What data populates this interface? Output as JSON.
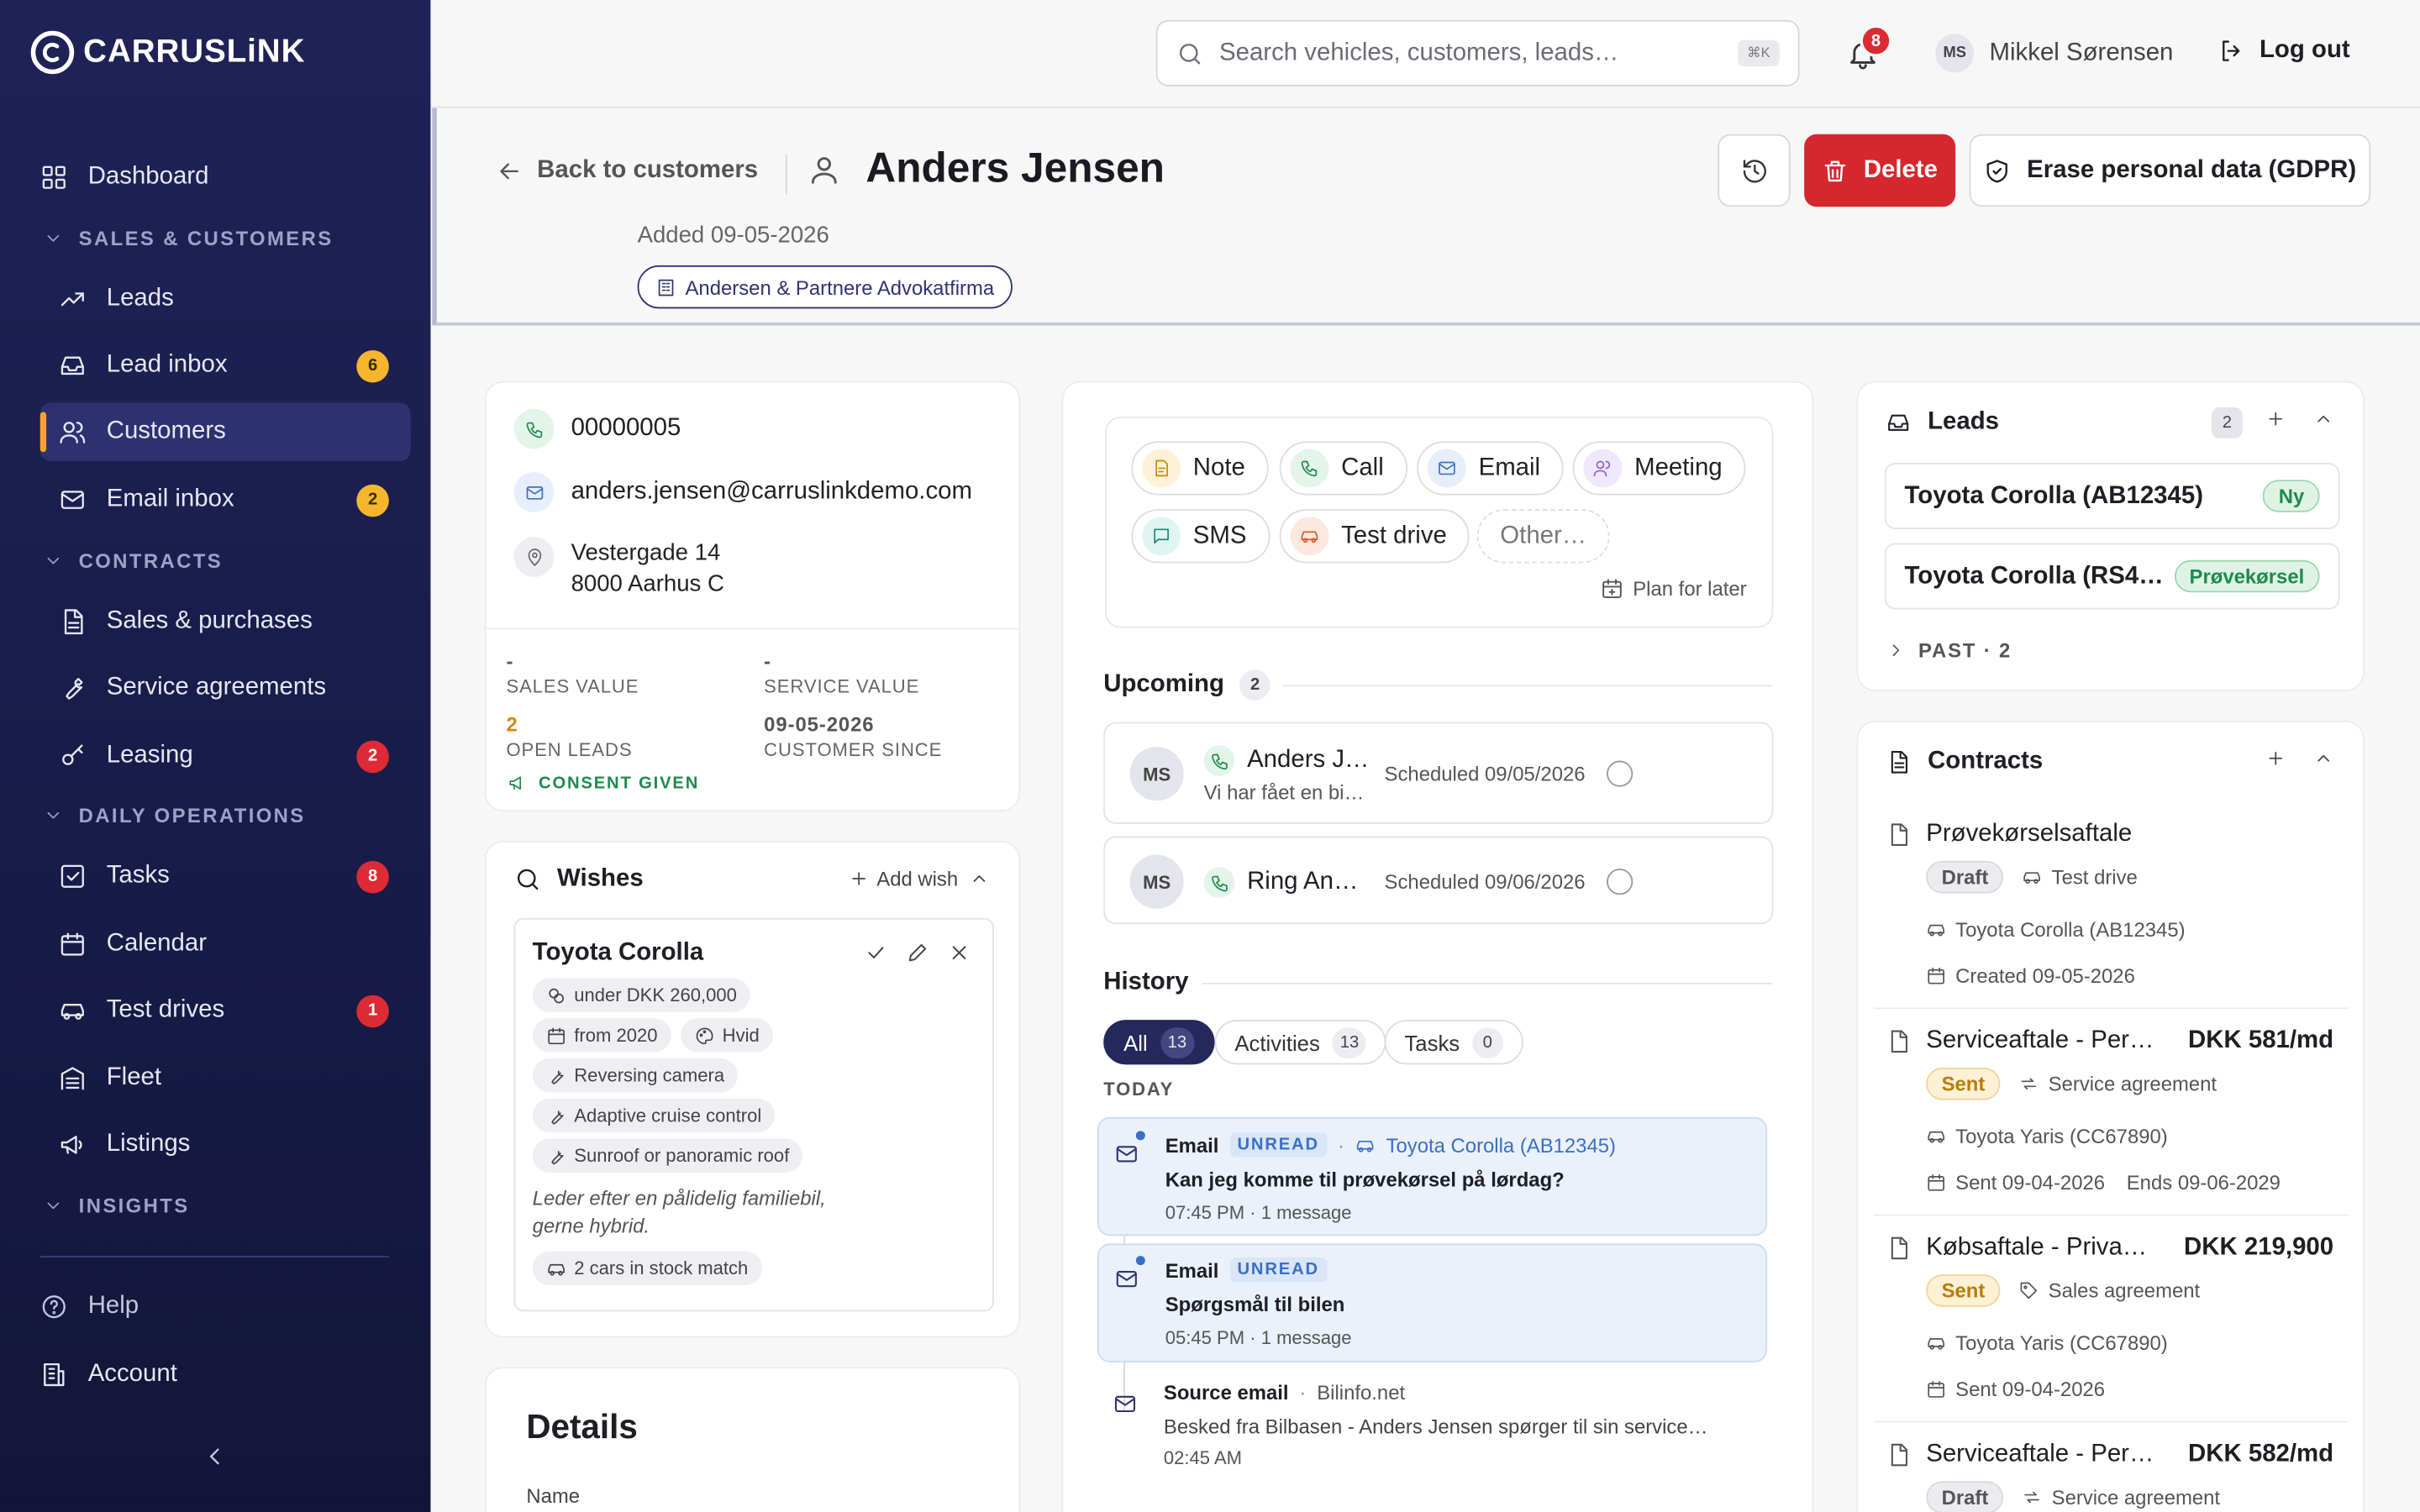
{
  "sidebar": {
    "brand": "CARRUSLiNK",
    "dashboard": "Dashboard",
    "sections": {
      "sales": "SALES & CUSTOMERS",
      "contracts": "CONTRACTS",
      "daily": "DAILY OPERATIONS",
      "insights": "INSIGHTS"
    },
    "items": {
      "leads": "Leads",
      "lead_inbox": "Lead inbox",
      "customers": "Customers",
      "email_inbox": "Email inbox",
      "sales_purchases": "Sales & purchases",
      "service_agreements": "Service agreements",
      "leasing": "Leasing",
      "tasks": "Tasks",
      "calendar": "Calendar",
      "test_drives": "Test drives",
      "fleet": "Fleet",
      "listings": "Listings"
    },
    "badges": {
      "lead_inbox": "6",
      "email_inbox": "2",
      "leasing": "2",
      "tasks": "8",
      "test_drives": "1"
    },
    "help": "Help",
    "account": "Account"
  },
  "topbar": {
    "search_placeholder": "Search vehicles, customers, leads…",
    "shortcut": "⌘K",
    "notifications": "8",
    "user_initials": "MS",
    "user_name": "Mikkel Sørensen",
    "logout": "Log out"
  },
  "header": {
    "back": "Back to customers",
    "name": "Anders Jensen",
    "added": "Added 09-05-2026",
    "company": "Andersen & Partnere Advokatfirma",
    "delete": "Delete",
    "gdpr": "Erase personal data (GDPR)"
  },
  "contact": {
    "phone": "00000005",
    "email": "anders.jensen@carruslinkdemo.com",
    "address_line1": "Vestergade 14",
    "address_line2": "8000 Aarhus C",
    "sales_value": "-",
    "sales_value_label": "SALES VALUE",
    "service_value": "-",
    "service_value_label": "SERVICE VALUE",
    "open_leads": "2",
    "open_leads_label": "OPEN LEADS",
    "customer_since": "09-05-2026",
    "customer_since_label": "CUSTOMER SINCE",
    "consent": "CONSENT GIVEN"
  },
  "wishes": {
    "title": "Wishes",
    "add": "Add wish",
    "car": "Toyota Corolla",
    "price": "under DKK 260,000",
    "year": "from 2020",
    "color": "Hvid",
    "features": [
      "Reversing camera",
      "Adaptive cruise control",
      "Sunroof or panoramic roof"
    ],
    "note": "Leder efter en pålidelig familiebil, gerne hybrid.",
    "stock_match": "2 cars in stock match"
  },
  "details": {
    "title": "Details",
    "name_label": "Name"
  },
  "activity": {
    "actions": {
      "note": "Note",
      "call": "Call",
      "email": "Email",
      "meeting": "Meeting",
      "sms": "SMS",
      "test_drive": "Test drive",
      "other": "Other…"
    },
    "plan_later": "Plan for later",
    "upcoming_title": "Upcoming",
    "upcoming_count": "2",
    "upcoming": [
      {
        "initials": "MS",
        "title": "Anders J…",
        "sub": "Vi har fået en bi…",
        "scheduled": "Scheduled 09/05/2026"
      },
      {
        "initials": "MS",
        "title": "Ring An…",
        "sub": "",
        "scheduled": "Scheduled 09/06/2026"
      }
    ],
    "history_title": "History",
    "tabs": [
      {
        "label": "All",
        "count": "13"
      },
      {
        "label": "Activities",
        "count": "13"
      },
      {
        "label": "Tasks",
        "count": "0"
      }
    ],
    "today": "TODAY",
    "history": [
      {
        "type": "Email",
        "badge": "UNREAD",
        "link": "Toyota Corolla (AB12345)",
        "subject": "Kan jeg komme til prøvekørsel på lørdag?",
        "time": "07:45 PM",
        "meta": "1 message"
      },
      {
        "type": "Email",
        "badge": "UNREAD",
        "subject": "Spørgsmål til bilen",
        "time": "05:45 PM",
        "meta": "1 message"
      },
      {
        "type": "Source email",
        "source": "Bilinfo.net",
        "body": "Besked fra Bilbasen - Anders Jensen spørger til sin service…",
        "time": "02:45 AM"
      }
    ]
  },
  "leads": {
    "title": "Leads",
    "count": "2",
    "items": [
      {
        "name": "Toyota Corolla (AB12345)",
        "status": "Ny"
      },
      {
        "name": "Toyota Corolla (RS4…",
        "status": "Prøvekørsel"
      }
    ],
    "past": "PAST · 2"
  },
  "contracts": {
    "title": "Contracts",
    "items": [
      {
        "title": "Prøvekørselsaftale",
        "price": "",
        "status": "Draft",
        "kind": "Test drive",
        "vehicle": "Toyota Corolla (AB12345)",
        "date": "Created 09-05-2026",
        "ends": ""
      },
      {
        "title": "Serviceaftale - Per…",
        "price": "DKK 581/md",
        "status": "Sent",
        "kind": "Service agreement",
        "vehicle": "Toyota Yaris (CC67890)",
        "date": "Sent 09-04-2026",
        "ends": "Ends 09-06-2029"
      },
      {
        "title": "Købsaftale - Priva…",
        "price": "DKK 219,900",
        "status": "Sent",
        "kind": "Sales agreement",
        "vehicle": "Toyota Yaris (CC67890)",
        "date": "Sent 09-04-2026",
        "ends": ""
      },
      {
        "title": "Serviceaftale - Per…",
        "price": "DKK 582/md",
        "status": "Draft",
        "kind": "Service agreement"
      }
    ]
  }
}
